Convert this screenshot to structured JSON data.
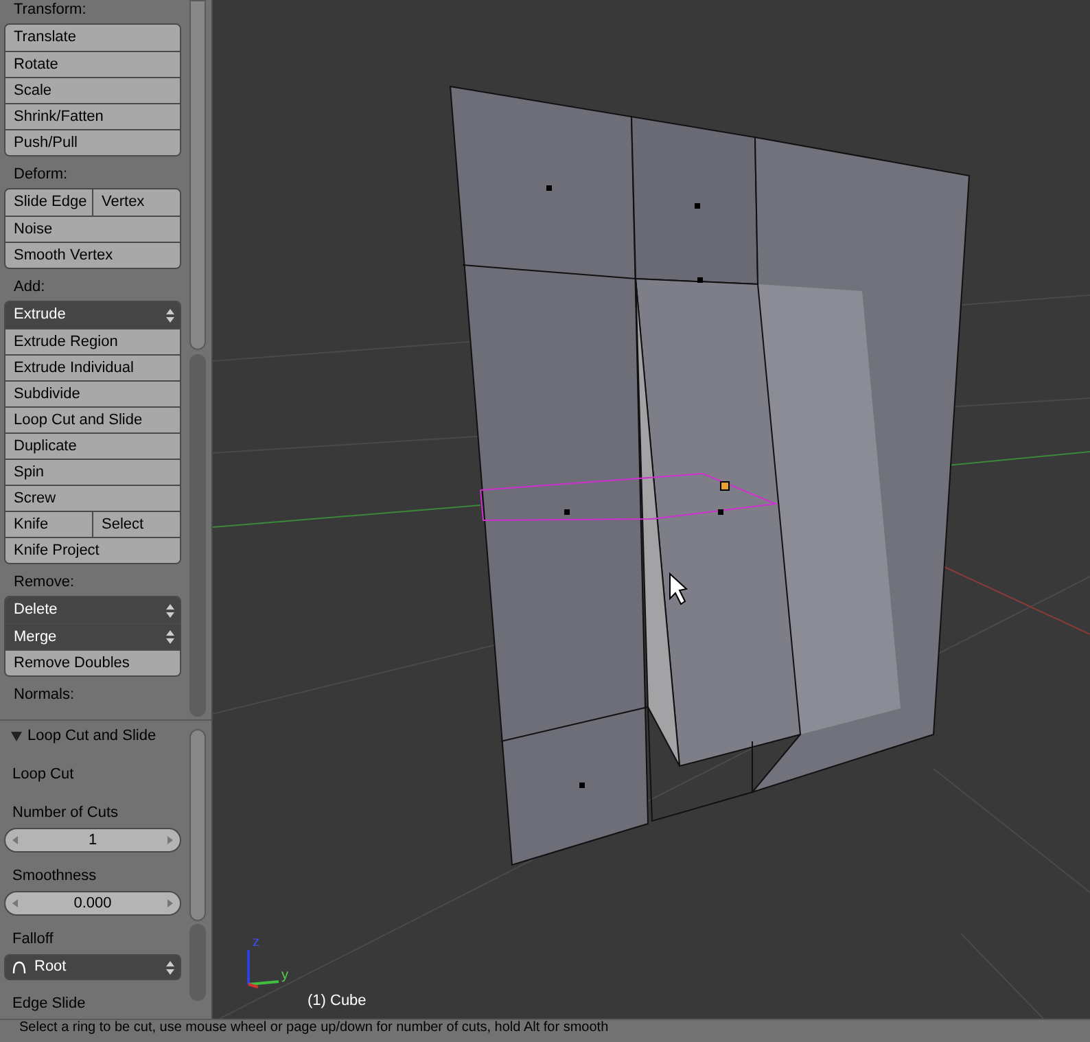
{
  "toolbar": {
    "sections": [
      {
        "title": "Transform:",
        "rows": [
          {
            "kind": "button",
            "labels": [
              "Translate"
            ]
          },
          {
            "kind": "button",
            "labels": [
              "Rotate"
            ]
          },
          {
            "kind": "button",
            "labels": [
              "Scale"
            ]
          },
          {
            "kind": "button",
            "labels": [
              "Shrink/Fatten"
            ]
          },
          {
            "kind": "button",
            "labels": [
              "Push/Pull"
            ]
          }
        ]
      },
      {
        "title": "Deform:",
        "rows": [
          {
            "kind": "button",
            "labels": [
              "Slide Edge",
              "Vertex"
            ]
          },
          {
            "kind": "button",
            "labels": [
              "Noise"
            ]
          },
          {
            "kind": "button",
            "labels": [
              "Smooth Vertex"
            ]
          }
        ]
      },
      {
        "title": "Add:",
        "rows": [
          {
            "kind": "dropdown",
            "labels": [
              "Extrude"
            ]
          },
          {
            "kind": "button",
            "labels": [
              "Extrude Region"
            ]
          },
          {
            "kind": "button",
            "labels": [
              "Extrude Individual"
            ]
          },
          {
            "kind": "button",
            "labels": [
              "Subdivide"
            ]
          },
          {
            "kind": "button",
            "labels": [
              "Loop Cut and Slide"
            ]
          },
          {
            "kind": "button",
            "labels": [
              "Duplicate"
            ]
          },
          {
            "kind": "button",
            "labels": [
              "Spin"
            ]
          },
          {
            "kind": "button",
            "labels": [
              "Screw"
            ]
          },
          {
            "kind": "button",
            "labels": [
              "Knife",
              "Select"
            ]
          },
          {
            "kind": "button",
            "labels": [
              "Knife Project"
            ]
          }
        ]
      },
      {
        "title": "Remove:",
        "rows": [
          {
            "kind": "dropdown",
            "labels": [
              "Delete"
            ]
          },
          {
            "kind": "dropdown",
            "labels": [
              "Merge"
            ]
          },
          {
            "kind": "button",
            "labels": [
              "Remove Doubles"
            ]
          }
        ]
      },
      {
        "title": "Normals:"
      }
    ]
  },
  "operator_panel": {
    "title": "Loop Cut and Slide",
    "expanded": true,
    "items": [
      {
        "kind": "label",
        "text": "Loop Cut"
      },
      {
        "kind": "label",
        "text": "Number of Cuts"
      },
      {
        "kind": "number",
        "value": "1"
      },
      {
        "kind": "label",
        "text": "Smoothness"
      },
      {
        "kind": "number",
        "value": "0.000"
      },
      {
        "kind": "label",
        "text": "Falloff"
      },
      {
        "kind": "dropdown",
        "value": "Root"
      },
      {
        "kind": "label",
        "text": "Edge Slide"
      }
    ]
  },
  "viewport": {
    "object_label": "(1) Cube",
    "axis_labels": [
      "z",
      "y"
    ]
  },
  "status_bar": {
    "text": "Select a ring to be cut, use mouse wheel or page up/down for number of cuts, hold Alt for smooth"
  }
}
